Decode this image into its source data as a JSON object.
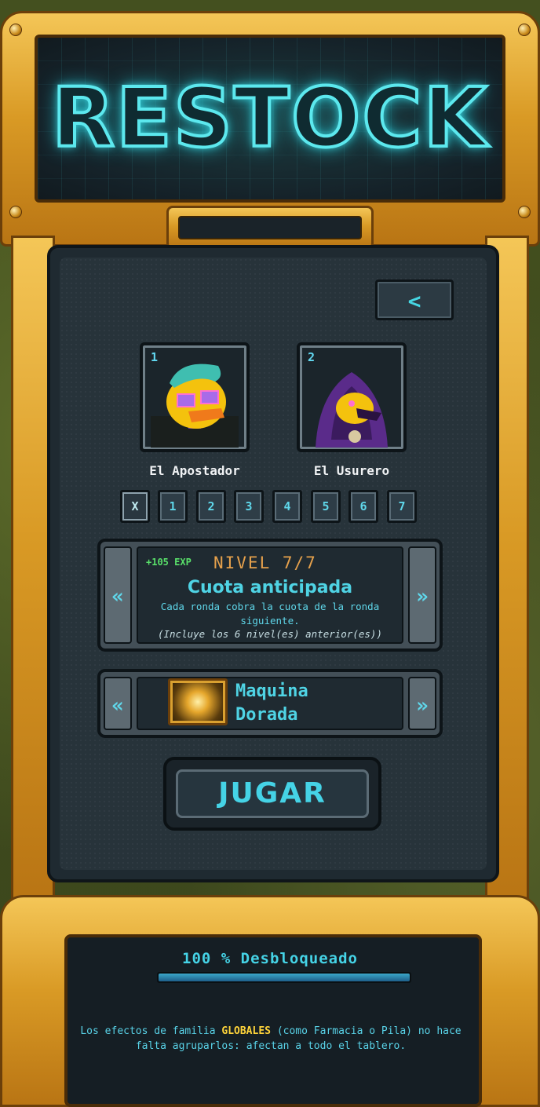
{
  "title": "RESTOCK",
  "back_button": {
    "icon": "chevron-left-icon",
    "label": "<"
  },
  "characters": [
    {
      "number": "1",
      "name": "El Apostador"
    },
    {
      "number": "2",
      "name": "El Usurero"
    }
  ],
  "level_buttons": [
    "X",
    "1",
    "2",
    "3",
    "4",
    "5",
    "6",
    "7"
  ],
  "level_info": {
    "exp": "+105 EXP",
    "level": "NIVEL 7/7",
    "title": "Cuota anticipada",
    "description": "Cada ronda cobra la cuota de la ronda siguiente.",
    "note": "(Incluye los 6 nivel(es) anterior(es))",
    "left_arrow": "«",
    "right_arrow": "»"
  },
  "machine": {
    "name_line1": "Maquina",
    "name_line2": "Dorada",
    "left_arrow": "«",
    "right_arrow": "»"
  },
  "play_button": "JUGAR",
  "unlock": {
    "text": "100 % Desbloqueado",
    "progress": 1.0
  },
  "tip": {
    "part1": "Los efectos de familia ",
    "highlight": "GLOBALES",
    "part2": " (como Farmacia o Pila) no hace falta agruparlos: afectan a todo el tablero."
  },
  "colors": {
    "accent": "#45d3e6",
    "gold": "#d99a25",
    "highlight": "#ffd43a",
    "exp": "#59e06a",
    "level": "#e6a14c"
  }
}
